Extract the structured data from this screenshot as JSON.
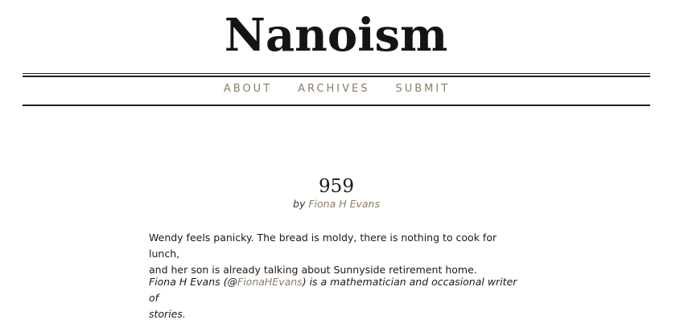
{
  "header": {
    "site_title": "Nanoism"
  },
  "nav": {
    "items": [
      {
        "label": "ABOUT"
      },
      {
        "label": "ARCHIVES"
      },
      {
        "label": "SUBMIT"
      }
    ]
  },
  "post": {
    "title": "959",
    "byline_prefix": "by",
    "author": "Fiona H Evans",
    "story_line_1": "Wendy feels panicky. The bread is moldy, there is nothing to cook for lunch,",
    "story_line_2": "and her son is already talking about Sunnyside retirement home.",
    "bio_name": "Fiona H Evans",
    "bio_open": "(@",
    "bio_handle": "FionaHEvans",
    "bio_close": ")",
    "bio_rest": "is a mathematician and occasional writer of",
    "bio_last": "stories."
  },
  "colors": {
    "link_accent": "#8c7c66",
    "text": "#1a1a1a",
    "rule": "#222222"
  }
}
